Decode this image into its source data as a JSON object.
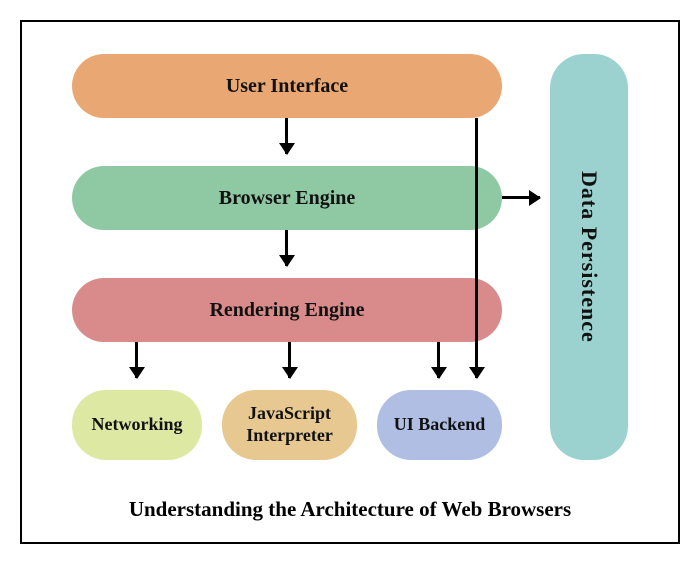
{
  "nodes": {
    "user_interface": "User Interface",
    "browser_engine": "Browser Engine",
    "rendering_engine": "Rendering Engine",
    "networking": "Networking",
    "javascript_interpreter": "JavaScript Interpreter",
    "ui_backend": "UI Backend",
    "data_persistence": "Data Persistence"
  },
  "caption": "Understanding the Architecture of Web Browsers",
  "colors": {
    "user_interface": "#e9a773",
    "browser_engine": "#8fc9a4",
    "rendering_engine": "#d98b8b",
    "networking": "#dde8a3",
    "javascript_interpreter": "#e7c890",
    "ui_backend": "#b0bee4",
    "data_persistence": "#9bd2d0"
  },
  "edges": [
    {
      "from": "user_interface",
      "to": "browser_engine"
    },
    {
      "from": "browser_engine",
      "to": "rendering_engine"
    },
    {
      "from": "rendering_engine",
      "to": "networking"
    },
    {
      "from": "rendering_engine",
      "to": "javascript_interpreter"
    },
    {
      "from": "rendering_engine",
      "to": "ui_backend"
    },
    {
      "from": "browser_engine",
      "to": "data_persistence"
    },
    {
      "from": "user_interface",
      "to": "ui_backend"
    }
  ]
}
